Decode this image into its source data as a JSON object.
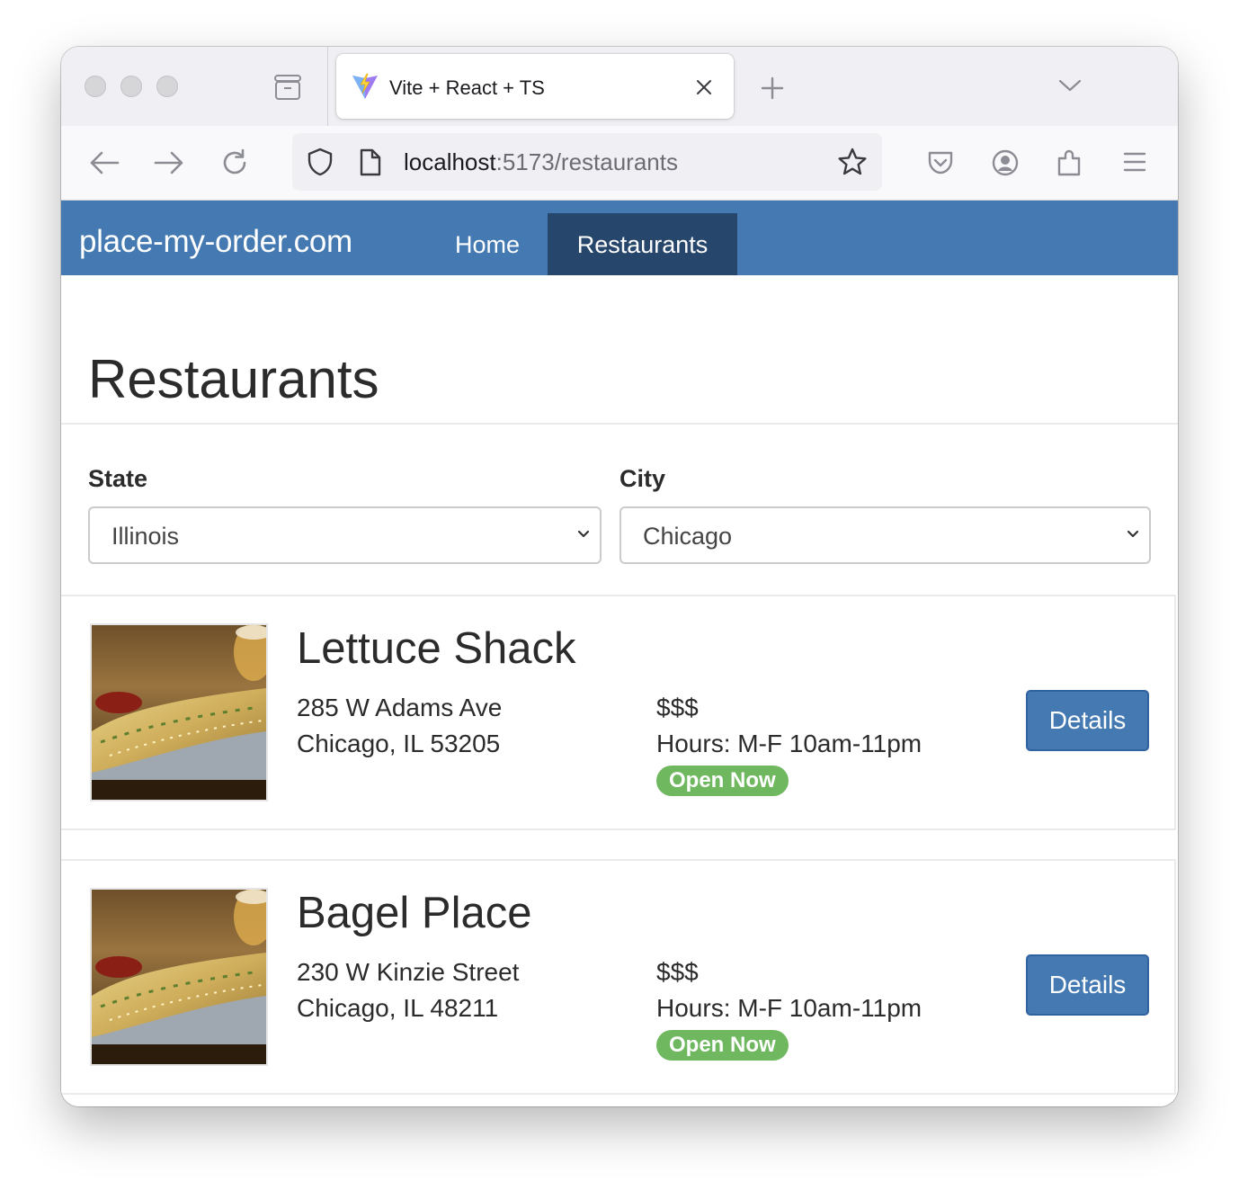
{
  "browser": {
    "tab_title": "Vite + React + TS",
    "url_host": "localhost",
    "url_rest": ":5173/restaurants"
  },
  "site": {
    "brand": "place-my-order.com",
    "nav": {
      "home": "Home",
      "restaurants": "Restaurants"
    }
  },
  "page": {
    "title": "Restaurants",
    "state_label": "State",
    "state_value": "Illinois",
    "city_label": "City",
    "city_value": "Chicago"
  },
  "restaurants": [
    {
      "name": "Lettuce Shack",
      "address_line1": "285 W Adams Ave",
      "address_line2": "Chicago, IL 53205",
      "price": "$$$",
      "hours": "Hours: M-F 10am-11pm",
      "status": "Open Now",
      "button": "Details"
    },
    {
      "name": "Bagel Place",
      "address_line1": "230 W Kinzie Street",
      "address_line2": "Chicago, IL 48211",
      "price": "$$$",
      "hours": "Hours: M-F 10am-11pm",
      "status": "Open Now",
      "button": "Details"
    }
  ],
  "icons": {
    "traffic_lights": [
      "close-dot",
      "minimize-dot",
      "zoom-dot"
    ],
    "tab_strip": [
      "firefox-view-icon",
      "vite-favicon",
      "tab-close-icon",
      "new-tab-icon",
      "tab-list-chevron-icon"
    ],
    "toolbar": [
      "back-arrow-icon",
      "forward-arrow-icon",
      "reload-icon",
      "shield-icon",
      "page-icon",
      "bookmark-star-icon",
      "pocket-icon",
      "account-icon",
      "extensions-icon",
      "app-menu-icon"
    ]
  },
  "colors": {
    "brand_bar": "#4479b2",
    "nav_active": "#27466b",
    "badge_open": "#6fb85f",
    "button": "#4479b2"
  }
}
